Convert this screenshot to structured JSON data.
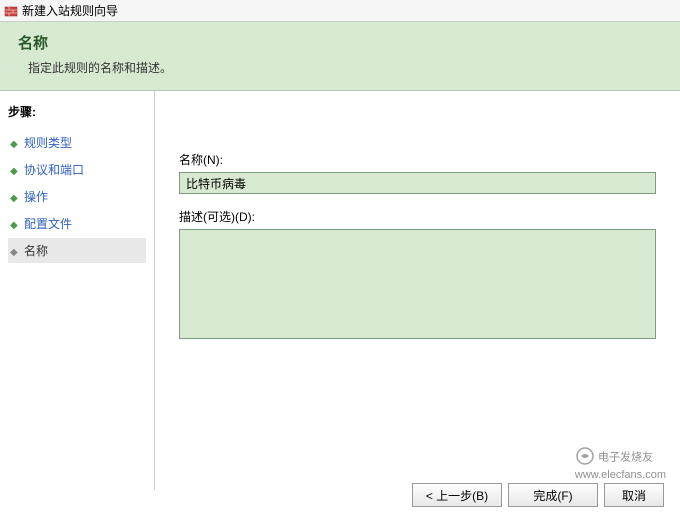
{
  "window": {
    "title": "新建入站规则向导"
  },
  "header": {
    "title": "名称",
    "subtitle": "指定此规则的名称和描述。"
  },
  "sidebar": {
    "title": "步骤:",
    "items": [
      {
        "label": "规则类型",
        "state": "completed"
      },
      {
        "label": "协议和端口",
        "state": "completed"
      },
      {
        "label": "操作",
        "state": "completed"
      },
      {
        "label": "配置文件",
        "state": "completed"
      },
      {
        "label": "名称",
        "state": "current"
      }
    ]
  },
  "form": {
    "name_label": "名称(N):",
    "name_value": "比特币病毒",
    "desc_label": "描述(可选)(D):",
    "desc_value": ""
  },
  "buttons": {
    "back": "< 上一步(B)",
    "finish": "完成(F)",
    "cancel": "取消"
  },
  "watermark": {
    "text": "电子发烧友",
    "url": "www.elecfans.com"
  }
}
